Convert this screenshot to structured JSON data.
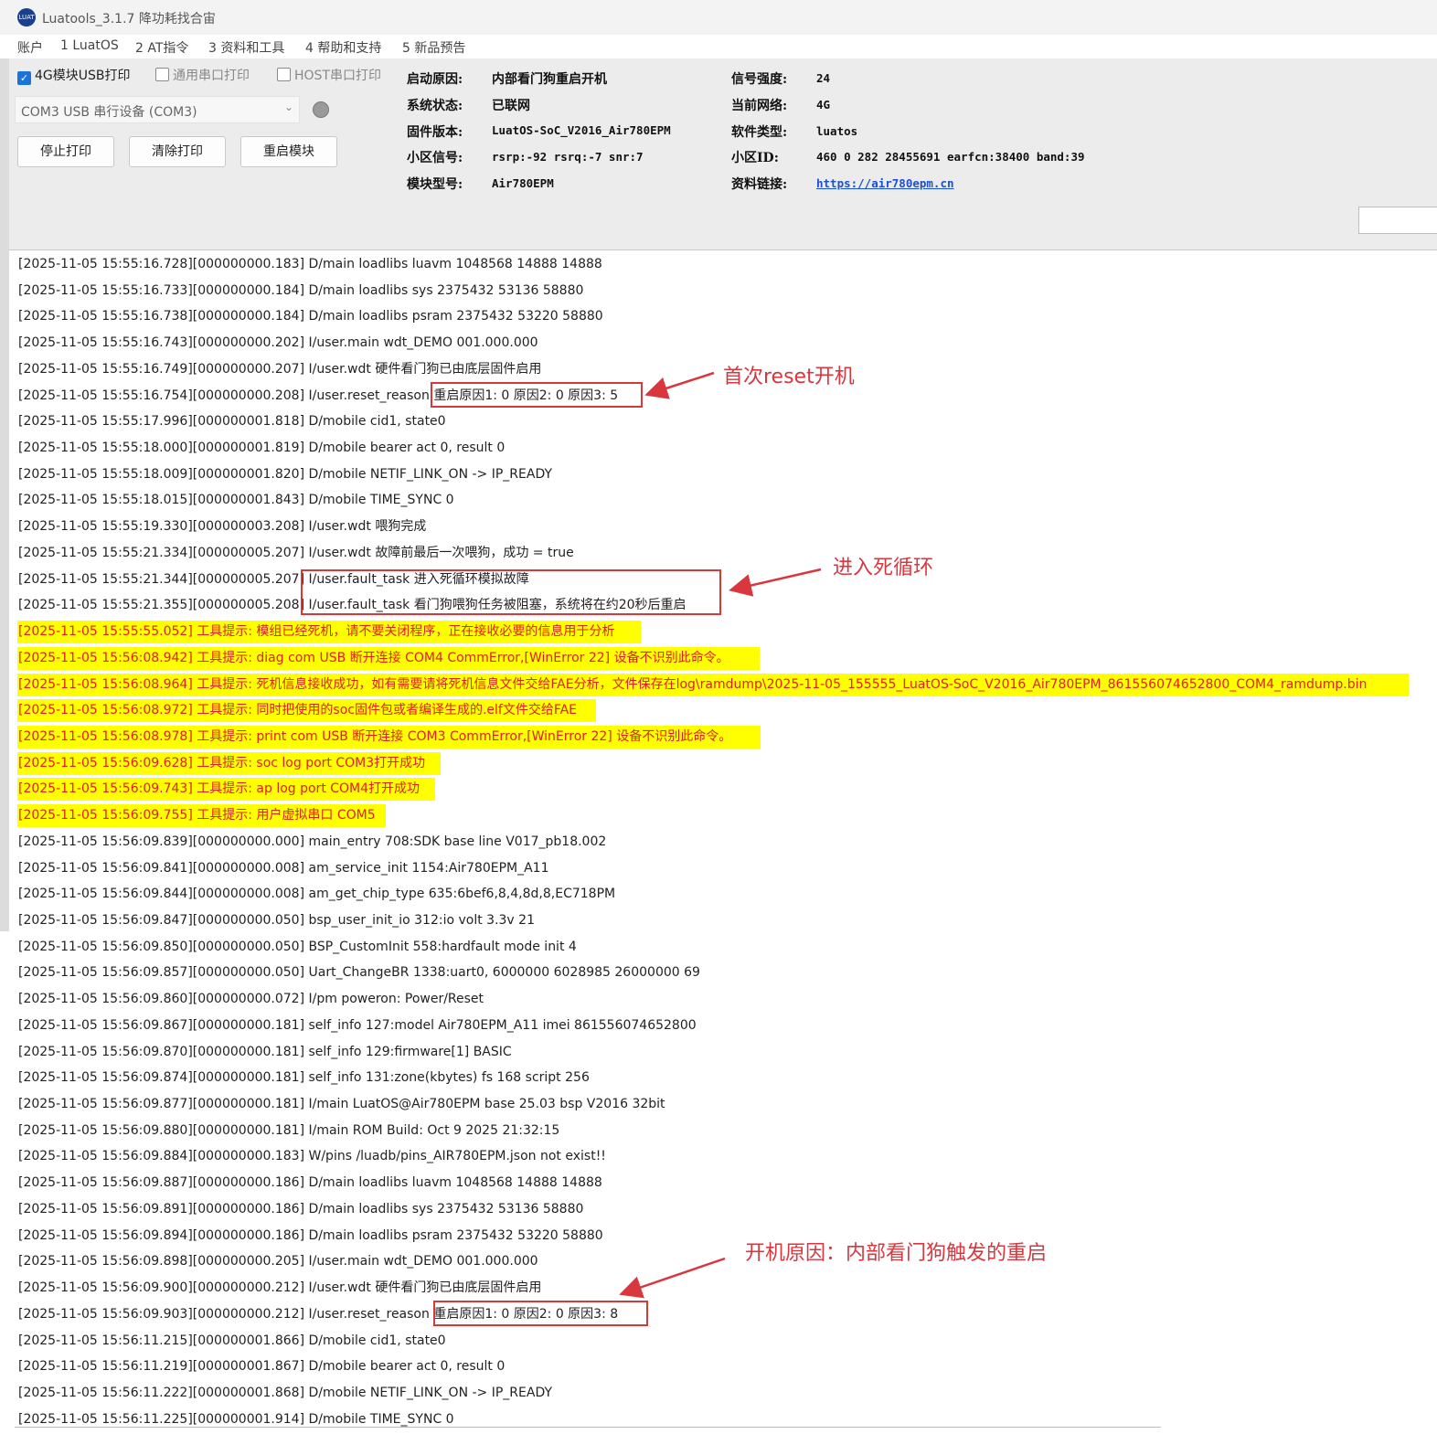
{
  "window": {
    "title": "Luatools_3.1.7 降功耗找合宙",
    "logo_text": "LUAT"
  },
  "menu": [
    "账户",
    "1 LuatOS",
    "2 AT指令",
    "3 资料和工具",
    "4 帮助和支持",
    "5 新品预告"
  ],
  "controls": {
    "checkboxes": [
      {
        "label": "4G模块USB打印",
        "checked": true
      },
      {
        "label": "通用串口打印",
        "checked": false
      },
      {
        "label": "HOST串口打印",
        "checked": false
      }
    ],
    "port_select": "COM3 USB 串行设备 (COM3)",
    "buttons": [
      "停止打印",
      "清除打印",
      "重启模块"
    ]
  },
  "info": {
    "boot_reason_label": "启动原因:",
    "boot_reason": "内部看门狗重启开机",
    "sys_state_label": "系统状态:",
    "sys_state": "已联网",
    "firmware_label": "固件版本:",
    "firmware": "LuatOS-SoC_V2016_Air780EPM",
    "cell_signal_label": "小区信号:",
    "cell_signal": "rsrp:-92 rsrq:-7 snr:7",
    "module_label": "模块型号:",
    "module": "Air780EPM",
    "signal_label": "信号强度:",
    "signal": "24",
    "network_label": "当前网络:",
    "network": "4G",
    "software_label": "软件类型:",
    "software": "luatos",
    "cell_id_label": "小区ID:",
    "cell_id": "460 0 282 28455691 earfcn:38400 band:39",
    "link_label": "资料链接:",
    "link": "https://air780epm.cn"
  },
  "log": [
    {
      "t": "[2025-11-05 15:55:16.728][000000000.183] D/main loadlibs luavm 1048568 14888 14888",
      "hl": false
    },
    {
      "t": "[2025-11-05 15:55:16.733][000000000.184] D/main loadlibs sys   2375432 53136 58880",
      "hl": false
    },
    {
      "t": "[2025-11-05 15:55:16.738][000000000.184] D/main loadlibs psram 2375432 53220 58880",
      "hl": false
    },
    {
      "t": "[2025-11-05 15:55:16.743][000000000.202] I/user.main wdt_DEMO 001.000.000",
      "hl": false
    },
    {
      "t": "[2025-11-05 15:55:16.749][000000000.207] I/user.wdt 硬件看门狗已由底层固件启用",
      "hl": false
    },
    {
      "t": "[2025-11-05 15:55:16.754][000000000.208] I/user.reset_reason 重启原因1: 0 原因2: 0 原因3: 5",
      "hl": false
    },
    {
      "t": "[2025-11-05 15:55:17.996][000000001.818] D/mobile cid1, state0",
      "hl": false
    },
    {
      "t": "[2025-11-05 15:55:18.000][000000001.819] D/mobile bearer act 0, result 0",
      "hl": false
    },
    {
      "t": "[2025-11-05 15:55:18.009][000000001.820] D/mobile NETIF_LINK_ON -> IP_READY",
      "hl": false
    },
    {
      "t": "[2025-11-05 15:55:18.015][000000001.843] D/mobile TIME_SYNC 0",
      "hl": false
    },
    {
      "t": "[2025-11-05 15:55:19.330][000000003.208] I/user.wdt 喂狗完成",
      "hl": false
    },
    {
      "t": "[2025-11-05 15:55:21.334][000000005.207] I/user.wdt 故障前最后一次喂狗，成功 = true",
      "hl": false
    },
    {
      "t": "[2025-11-05 15:55:21.344][000000005.207] I/user.fault_task 进入死循环模拟故障",
      "hl": false
    },
    {
      "t": "[2025-11-05 15:55:21.355][000000005.208] I/user.fault_task 看门狗喂狗任务被阻塞，系统将在约20秒后重启",
      "hl": false
    },
    {
      "t": "[2025-11-05 15:55:55.052] 工具提示: 模组已经死机，请不要关闭程序，正在接收必要的信息用于分析",
      "hl": true
    },
    {
      "t": "[2025-11-05 15:56:08.942] 工具提示: diag com USB 断开连接 COM4 CommError,[WinError 22] 设备不识别此命令。",
      "hl": true
    },
    {
      "t": "[2025-11-05 15:56:08.964] 工具提示: 死机信息接收成功，如有需要请将死机信息文件交给FAE分析，文件保存在log\\ramdump\\2025-11-05_155555_LuatOS-SoC_V2016_Air780EPM_861556074652800_COM4_ramdump.bin",
      "hl": true
    },
    {
      "t": "[2025-11-05 15:56:08.972] 工具提示: 同时把使用的soc固件包或者编译生成的.elf文件交给FAE",
      "hl": true
    },
    {
      "t": "[2025-11-05 15:56:08.978] 工具提示: print com USB 断开连接 COM3 CommError,[WinError 22] 设备不识别此命令。",
      "hl": true
    },
    {
      "t": "[2025-11-05 15:56:09.628] 工具提示: soc log port COM3打开成功",
      "hl": true
    },
    {
      "t": "[2025-11-05 15:56:09.743] 工具提示: ap log port COM4打开成功",
      "hl": true
    },
    {
      "t": "[2025-11-05 15:56:09.755] 工具提示: 用户虚拟串口 COM5",
      "hl": true
    },
    {
      "t": "[2025-11-05 15:56:09.839][000000000.000] main_entry 708:SDK base line V017_pb18.002",
      "hl": false
    },
    {
      "t": "[2025-11-05 15:56:09.841][000000000.008] am_service_init 1154:Air780EPM_A11",
      "hl": false
    },
    {
      "t": "[2025-11-05 15:56:09.844][000000000.008] am_get_chip_type 635:6bef6,8,4,8d,8,EC718PM",
      "hl": false
    },
    {
      "t": "[2025-11-05 15:56:09.847][000000000.050] bsp_user_init_io 312:io volt 3.3v 21",
      "hl": false
    },
    {
      "t": "[2025-11-05 15:56:09.850][000000000.050] BSP_CustomInit 558:hardfault mode init 4",
      "hl": false
    },
    {
      "t": "[2025-11-05 15:56:09.857][000000000.050] Uart_ChangeBR 1338:uart0, 6000000 6028985 26000000 69",
      "hl": false
    },
    {
      "t": "[2025-11-05 15:56:09.860][000000000.072] I/pm poweron: Power/Reset",
      "hl": false
    },
    {
      "t": "[2025-11-05 15:56:09.867][000000000.181] self_info 127:model Air780EPM_A11 imei 861556074652800",
      "hl": false
    },
    {
      "t": "[2025-11-05 15:56:09.870][000000000.181] self_info 129:firmware[1] BASIC",
      "hl": false
    },
    {
      "t": "[2025-11-05 15:56:09.874][000000000.181] self_info 131:zone(kbytes) fs 168 script 256",
      "hl": false
    },
    {
      "t": "[2025-11-05 15:56:09.877][000000000.181] I/main LuatOS@Air780EPM base 25.03 bsp V2016 32bit",
      "hl": false
    },
    {
      "t": "[2025-11-05 15:56:09.880][000000000.181] I/main ROM Build: Oct  9 2025 21:32:15",
      "hl": false
    },
    {
      "t": "[2025-11-05 15:56:09.884][000000000.183] W/pins /luadb/pins_AIR780EPM.json not exist!!",
      "hl": false
    },
    {
      "t": "[2025-11-05 15:56:09.887][000000000.186] D/main loadlibs luavm 1048568 14888 14888",
      "hl": false
    },
    {
      "t": "[2025-11-05 15:56:09.891][000000000.186] D/main loadlibs sys   2375432 53136 58880",
      "hl": false
    },
    {
      "t": "[2025-11-05 15:56:09.894][000000000.186] D/main loadlibs psram 2375432 53220 58880",
      "hl": false
    },
    {
      "t": "[2025-11-05 15:56:09.898][000000000.205] I/user.main wdt_DEMO 001.000.000",
      "hl": false
    },
    {
      "t": "[2025-11-05 15:56:09.900][000000000.212] I/user.wdt 硬件看门狗已由底层固件启用",
      "hl": false
    },
    {
      "t": "[2025-11-05 15:56:09.903][000000000.212] I/user.reset_reason 重启原因1: 0 原因2: 0 原因3: 8",
      "hl": false
    },
    {
      "t": "[2025-11-05 15:56:11.215][000000001.866] D/mobile cid1, state0",
      "hl": false
    },
    {
      "t": "[2025-11-05 15:56:11.219][000000001.867] D/mobile bearer act 0, result 0",
      "hl": false
    },
    {
      "t": "[2025-11-05 15:56:11.222][000000001.868] D/mobile NETIF_LINK_ON -> IP_READY",
      "hl": false
    },
    {
      "t": "[2025-11-05 15:56:11.225][000000001.914] D/mobile TIME_SYNC 0",
      "hl": false
    }
  ],
  "annotations": {
    "first_reset": "首次reset开机",
    "dead_loop": "进入死循环",
    "boot_reason": "开机原因：内部看门狗触发的重启",
    "color": "#d9363e"
  }
}
